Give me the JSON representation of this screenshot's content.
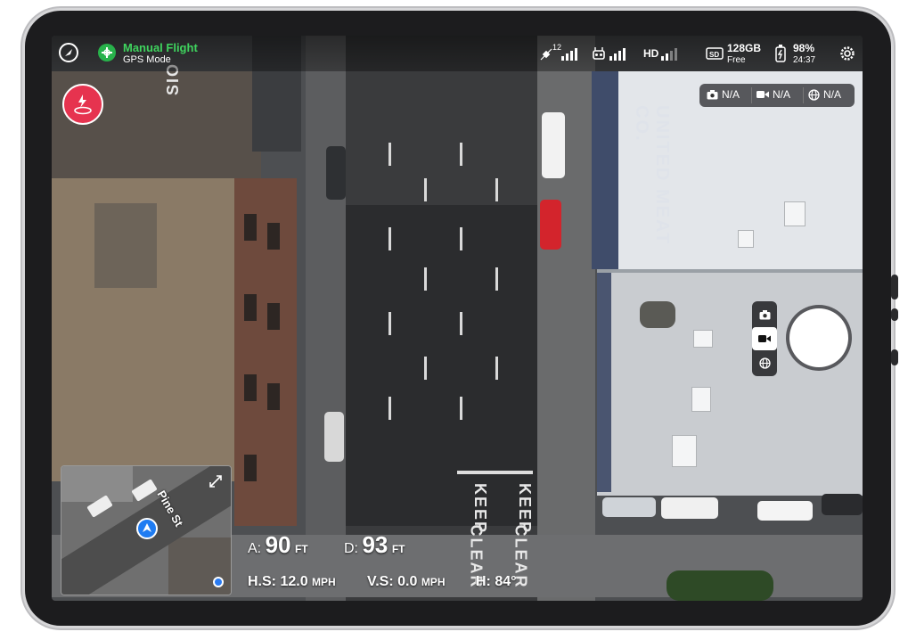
{
  "flight": {
    "mode_title": "Manual Flight",
    "mode_subtitle": "GPS Mode"
  },
  "status": {
    "satellites": "12",
    "video": "HD",
    "storage": "128GB",
    "storage_sub": "Free",
    "battery": "98%",
    "battery_time": "24:37"
  },
  "camera_info": {
    "photo": "N/A",
    "video": "N/A",
    "panorama": "N/A"
  },
  "scene_text": {
    "building_sign": "UNITED MEAT CO.",
    "road_keep": "KEEP",
    "road_keep2": "KEEP",
    "road_clear": "CLEAR",
    "road_clear2": "CLEAR",
    "corner_sign": "SIO"
  },
  "minimap": {
    "street_label": "Pine St"
  },
  "telemetry": {
    "altitude_label": "A:",
    "altitude_value": "90",
    "altitude_unit": "FT",
    "distance_label": "D:",
    "distance_value": "93",
    "distance_unit": "FT",
    "hspeed_label": "H.S:",
    "hspeed_value": "12.0",
    "hspeed_unit": "MPH",
    "vspeed_label": "V.S:",
    "vspeed_value": "0.0",
    "vspeed_unit": "MPH",
    "heading_label": "H:",
    "heading_value": "84°"
  },
  "icons": [
    "home-icon",
    "gps-icon",
    "satellite-icon",
    "remote-signal-icon",
    "hd-signal-icon",
    "sd-card-icon",
    "battery-icon",
    "settings-icon",
    "takeoff-icon",
    "camera-icon",
    "video-icon",
    "globe-icon",
    "expand-icon",
    "aircraft-icon",
    "location-dot-icon"
  ],
  "colors": {
    "accent_green": "#3fd45e",
    "takeoff_red": "#e6334f",
    "map_blue": "#1f7cf2"
  }
}
